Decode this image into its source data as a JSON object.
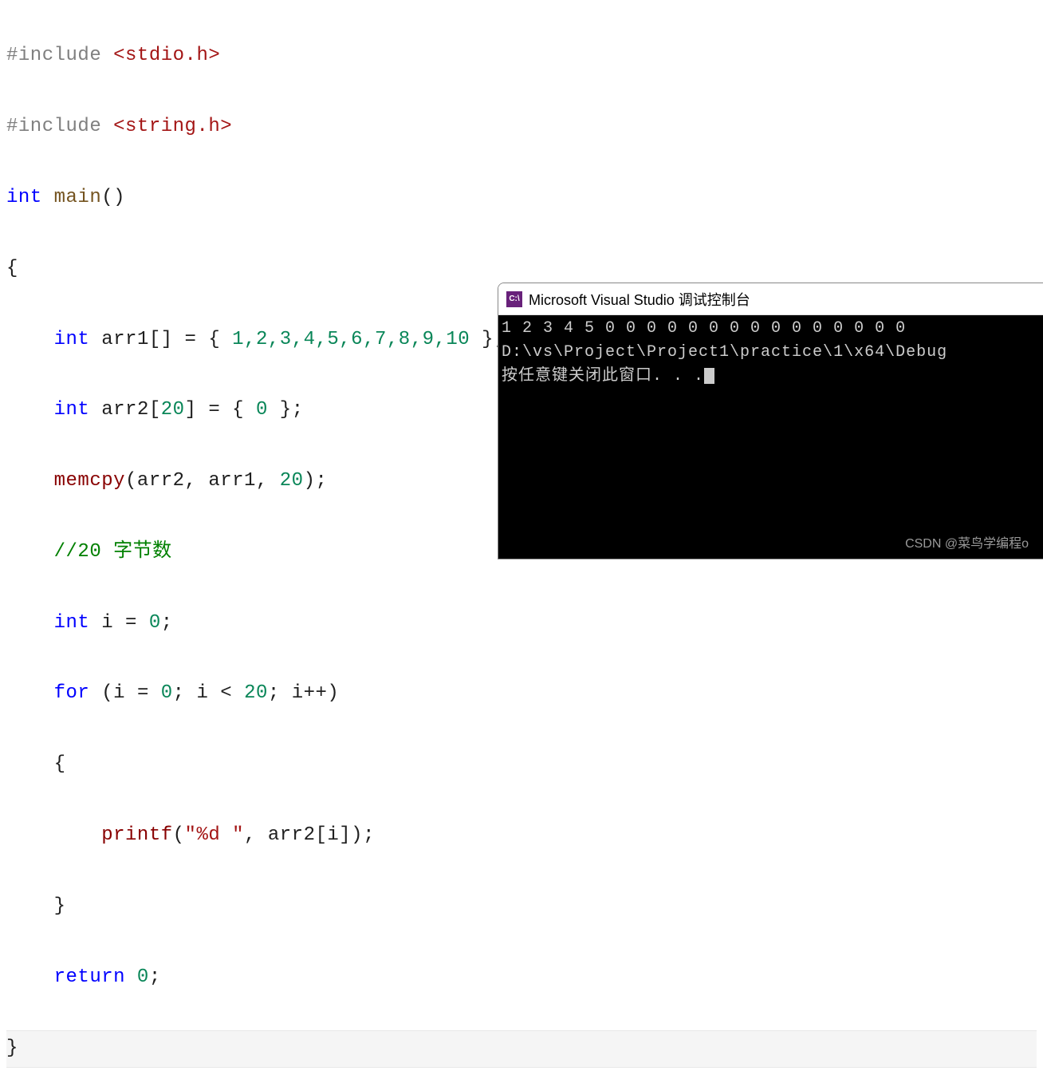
{
  "code": {
    "include1_directive": "#include",
    "include1_header": " <stdio.h>",
    "include2_directive": "#include",
    "include2_header": " <string.h>",
    "ret_type": "int",
    "main_name": " main",
    "main_parens": "()",
    "brace_open": "{",
    "indent1": "    ",
    "indent2": "        ",
    "arr1_decl_kw": "int",
    "arr1_decl_name": " arr1[] = { ",
    "arr1_vals": "1,2,3,4,5,6,7,8,9,10",
    "arr1_end": " };",
    "arr2_decl_kw": "int",
    "arr2_decl_name": " arr2[",
    "arr2_size": "20",
    "arr2_mid": "] = { ",
    "arr2_init": "0",
    "arr2_end": " };",
    "memcpy_fn": "memcpy",
    "memcpy_args_open": "(arr2, arr1, ",
    "memcpy_count": "20",
    "memcpy_args_close": ");",
    "comment": "//20 字节数",
    "i_decl_kw": "int",
    "i_decl": " i = ",
    "i_init": "0",
    "i_semi": ";",
    "for_kw": "for",
    "for_open": " (i = ",
    "for_zero": "0",
    "for_mid1": "; i < ",
    "for_limit": "20",
    "for_mid2": "; i++)",
    "brace_open2": "{",
    "printf_fn": "printf",
    "printf_open": "(",
    "printf_fmt": "\"%d \"",
    "printf_mid": ", arr2[i]);",
    "brace_close2": "}",
    "return_kw": "return",
    "return_val": " 0",
    "return_semi": ";",
    "brace_close": "}"
  },
  "console": {
    "title": "Microsoft Visual Studio 调试控制台",
    "icon_text": "C:\\",
    "line1": "1 2 3 4 5 0 0 0 0 0 0 0 0 0 0 0 0 0 0 0",
    "line2": "D:\\vs\\Project\\Project1\\practice\\1\\x64\\Debug",
    "line3": "按任意键关闭此窗口. . ."
  },
  "watermark": "CSDN @菜鸟学编程o"
}
